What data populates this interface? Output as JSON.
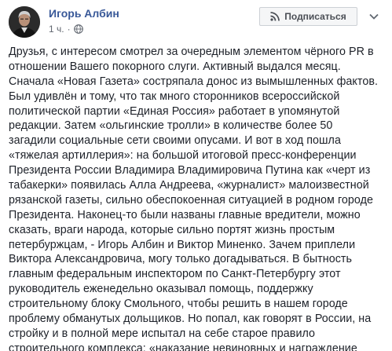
{
  "author": {
    "name": "Игорь Албин",
    "avatar_icon": "profile-photo",
    "time": "1 ч.",
    "separator": "·",
    "audience_icon": "globe-icon"
  },
  "actions": {
    "subscribe_label": "Подписаться",
    "subscribe_icon": "rss-icon",
    "more_icon": "chevron-down-icon"
  },
  "post": {
    "lines": [
      "Друзья, с интересом смотрел за очередным элементом чёрного PR в",
      "отношении Вашего покорного слуги. Активный выдался месяц.",
      "Сначала «Новая Газета» состряпала донос из вымышленных фактов.",
      "Был удивлён и тому, что так много сторонников всероссийской",
      "политической партии «Единая Россия» работает в упомянутой",
      "редакции. Затем «ольгинские тролли» в количестве более 50",
      "загадили социальные сети своими опусами. И вот в ход пошла",
      "«тяжелая артиллерия»: на большой итоговой пресс-конференции",
      "Президента России Владимира Владимировича Путина как «черт из",
      "табакерки» появилась Алла Андреева, «журналист» малоизвестной",
      "рязанской газеты, сильно обеспокоенная ситуацией в родном городе",
      "Президента. Наконец-то были названы главные вредители, можно",
      "сказать, враги народа, которые сильно портят жизнь простым",
      "петербуржцам, - Игорь Албин и Виктор Миненко. Зачем приплели",
      "Виктора Александровича, могу только догадываться. В бытность",
      "главным федеральным инспектором по Санкт-Петербургу этот",
      "руководитель еженедельно оказывал помощь, поддержку",
      "строительному блоку Смольного, чтобы решить в нашем городе",
      "проблему обманутых дольщиков. Но попал, как говорят в России, на",
      "стройку и в полной мере испытал на себе старое правило",
      "строительного комплекса: «наказание невиновных и награждение"
    ]
  }
}
